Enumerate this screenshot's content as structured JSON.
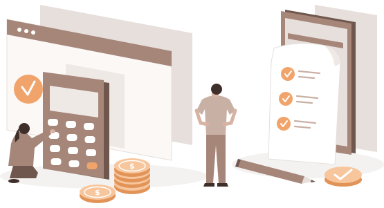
{
  "illustration": {
    "browser_window": {
      "dot_count": 3
    },
    "calculator": {
      "key_rows": 4,
      "key_cols": 3,
      "accent_key_row": 3,
      "accent_key_col": 2
    },
    "checklist": {
      "items": 3,
      "checked_items": 3
    },
    "coins": {
      "stack_count": 5,
      "currency_symbol": "$"
    }
  },
  "colors": {
    "back_panel": "#e6dfdc",
    "brown": "#a58679",
    "brown_dark": "#6f574d",
    "beige_light": "#efe9e6",
    "window_light": "#fbf8f6",
    "orange": "#f0a46b",
    "orange_light": "#f7c69c",
    "paper": "#ffffff",
    "ground_shadow": "#eeeeee",
    "skin": "#d8b3a3"
  }
}
